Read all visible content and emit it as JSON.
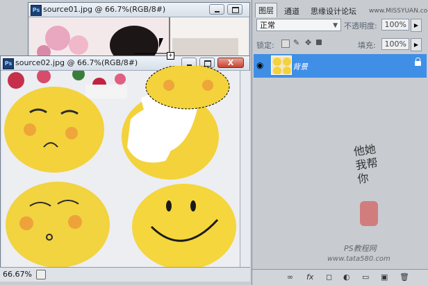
{
  "windows": {
    "back": {
      "title": "source01.jpg @ 66.7%(RGB/8#)",
      "ps_badge": "Ps"
    },
    "front": {
      "title": "source02.jpg @ 66.7%(RGB/8#)",
      "ps_badge": "Ps",
      "close_label": "X"
    }
  },
  "status_bar": {
    "zoom": "66.67%"
  },
  "panel": {
    "tabs": [
      {
        "label": "图层"
      },
      {
        "label": "通道"
      },
      {
        "label": "思缘设计论坛"
      }
    ],
    "watermark_site": "www.MISSYUAN.com",
    "blend_mode": "正常",
    "opacity_label": "不透明度:",
    "opacity_value": "100%",
    "lock_label": "锁定:",
    "fill_label": "填充:",
    "fill_value": "100%",
    "layer": {
      "name": "背景"
    },
    "watermark_text": "PS教程网",
    "watermark_url": "www.tata580.com"
  },
  "colors": {
    "selected_layer": "#3f8fe6",
    "close_button": "#c7432f"
  }
}
